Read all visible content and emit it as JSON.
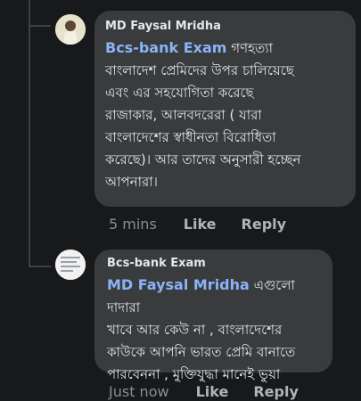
{
  "comments": [
    {
      "author": "MD Faysal Mridha",
      "mention": "Bcs-bank Exam",
      "text": " গণহত্যা\nবাংলাদেশ প্রেমিদের উপর চালিয়েছে\nএবং এর সহযোগিতা করেছে\nরাজাকার, আলবদরেরা ( যারা\nবাংলাদেশের স্বাধীনতা বিরোধিতা\nকরেছে)। আর তাদের অনুসারী হচ্ছেন\nআপনারা।",
      "time": "5 mins",
      "like": "Like",
      "reply": "Reply"
    },
    {
      "author": "Bcs-bank Exam",
      "mention": "MD Faysal Mridha",
      "text": " এগুলো দাদারা\nখাবে আর কেউ না , বাংলাদেশের\nকাউকে আপনি ভারত প্রেমি বানাতে\nপারবেননা ,  মুক্তিযুদ্ধা মানেই ভুয়া",
      "time": "Just now",
      "like": "Like",
      "reply": "Reply"
    }
  ]
}
